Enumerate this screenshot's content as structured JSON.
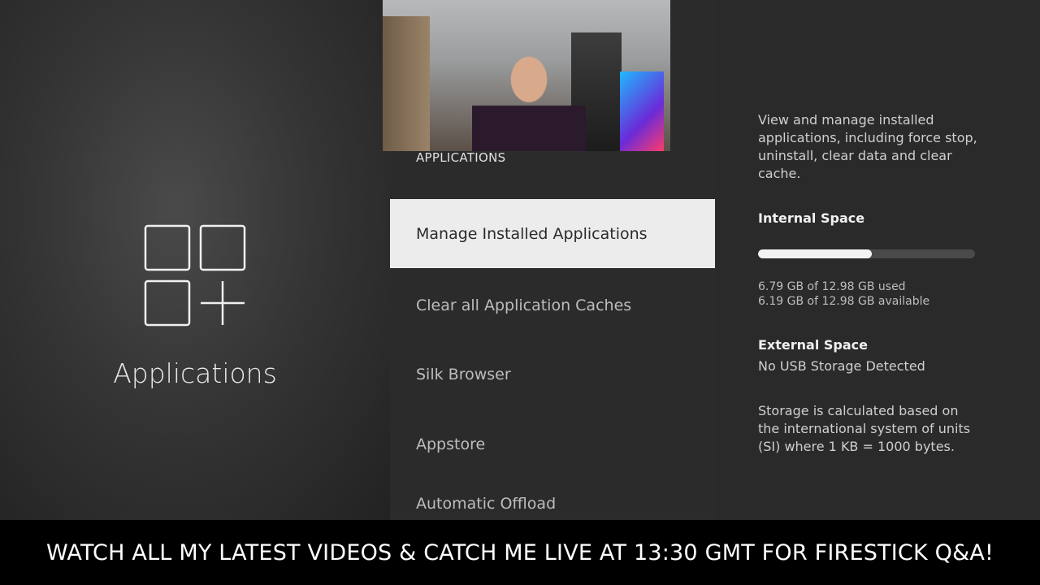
{
  "left": {
    "title": "Applications",
    "icon": "applications-grid-plus-icon"
  },
  "menu": {
    "section_title": "APPLICATIONS",
    "items": [
      {
        "label": "Manage Installed Applications",
        "selected": true
      },
      {
        "label": "Clear all Application Caches",
        "selected": false
      },
      {
        "label": "Silk Browser",
        "selected": false
      },
      {
        "label": "Appstore",
        "selected": false
      },
      {
        "label": "Automatic Offload",
        "selected": false
      }
    ]
  },
  "details": {
    "description": "View and manage installed applications, including force stop, uninstall, clear data and clear cache.",
    "internal_label": "Internal Space",
    "internal_used_fraction": 0.523,
    "internal_used": "6.79 GB of 12.98 GB used",
    "internal_available": "6.19 GB of 12.98 GB available",
    "external_label": "External Space",
    "external_value": "No USB Storage Detected",
    "storage_note": "Storage is calculated based on the international system of units (SI) where 1 KB = 1000 bytes."
  },
  "banner": {
    "text": "WATCH ALL MY LATEST VIDEOS & CATCH ME LIVE AT 13:30 GMT FOR FIRESTICK Q&A!"
  },
  "colors": {
    "selected_bg": "#ececec",
    "progress_fill": "#f2f2f2",
    "banner_bg": "#000000"
  }
}
